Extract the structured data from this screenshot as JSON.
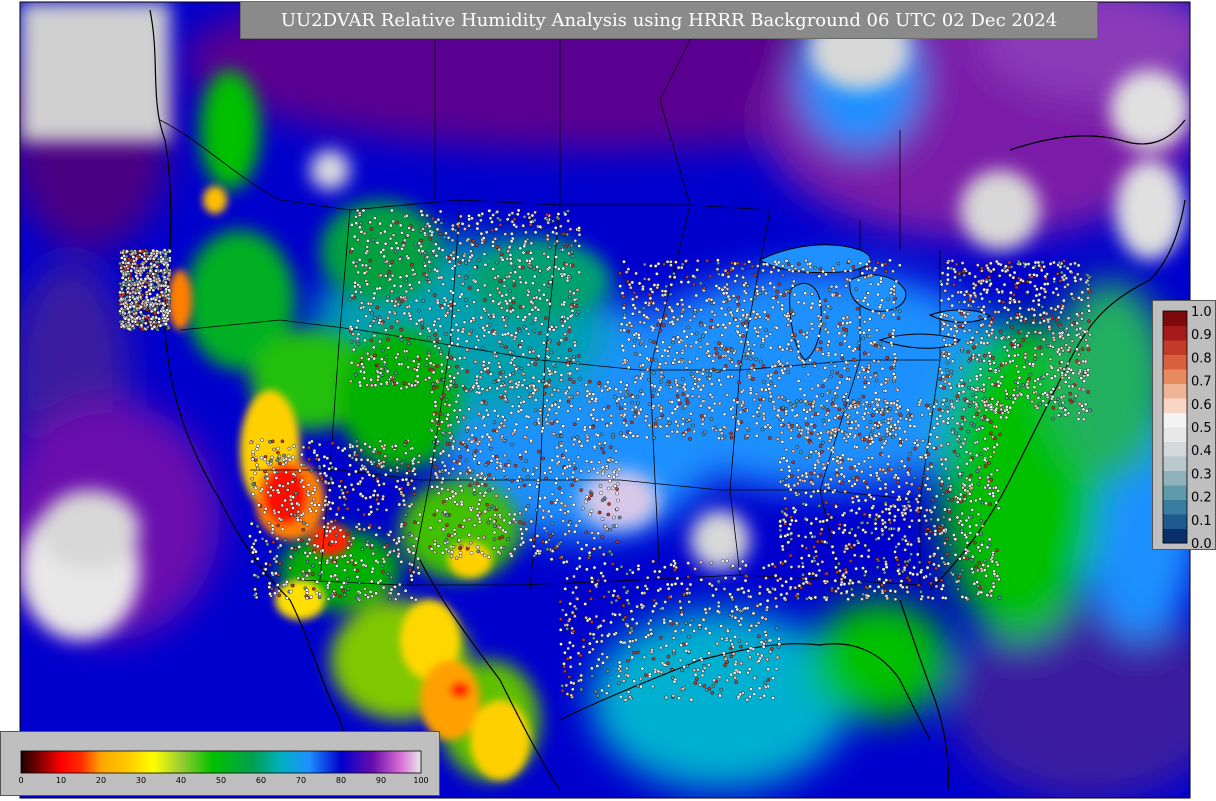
{
  "title": "UU2DVAR Relative Humidity Analysis using HRRR Background 06 UTC 02 Dec 2024",
  "humidity_colorbar": {
    "ticks": [
      "0",
      "10",
      "20",
      "30",
      "40",
      "50",
      "60",
      "70",
      "80",
      "90",
      "100"
    ],
    "stops": [
      {
        "value": 0,
        "color": "#1a0000"
      },
      {
        "value": 5,
        "color": "#8b0000"
      },
      {
        "value": 10,
        "color": "#ff0000"
      },
      {
        "value": 15,
        "color": "#ff2a00"
      },
      {
        "value": 20,
        "color": "#ffa500"
      },
      {
        "value": 27,
        "color": "#ffcc00"
      },
      {
        "value": 33,
        "color": "#ffff00"
      },
      {
        "value": 40,
        "color": "#9acd32"
      },
      {
        "value": 48,
        "color": "#00c000"
      },
      {
        "value": 58,
        "color": "#00a050"
      },
      {
        "value": 65,
        "color": "#00b0c0"
      },
      {
        "value": 72,
        "color": "#1e90ff"
      },
      {
        "value": 80,
        "color": "#0000cd"
      },
      {
        "value": 88,
        "color": "#6a0dad"
      },
      {
        "value": 95,
        "color": "#da70d6"
      },
      {
        "value": 100,
        "color": "#e8e8e8"
      }
    ]
  },
  "ratio_colorbar": {
    "ticks": [
      "0.0",
      "0.1",
      "0.2",
      "0.3",
      "0.4",
      "0.5",
      "0.6",
      "0.7",
      "0.8",
      "0.9",
      "1.0"
    ],
    "colors": [
      "#08306b",
      "#1f5a8e",
      "#3a7ca0",
      "#5e9aab",
      "#8eb3ba",
      "#b8c8cc",
      "#d4d9db",
      "#e8e8e8",
      "#f4f4f4",
      "#f8d8c4",
      "#efb495",
      "#e88a60",
      "#d8603c",
      "#c23b28",
      "#a51a1a",
      "#7d0a0a"
    ]
  },
  "colors": {
    "background_fill": "#d0d0d0",
    "panel_gray": "#bfbfbf",
    "title_bar": "#8a8a8a"
  }
}
